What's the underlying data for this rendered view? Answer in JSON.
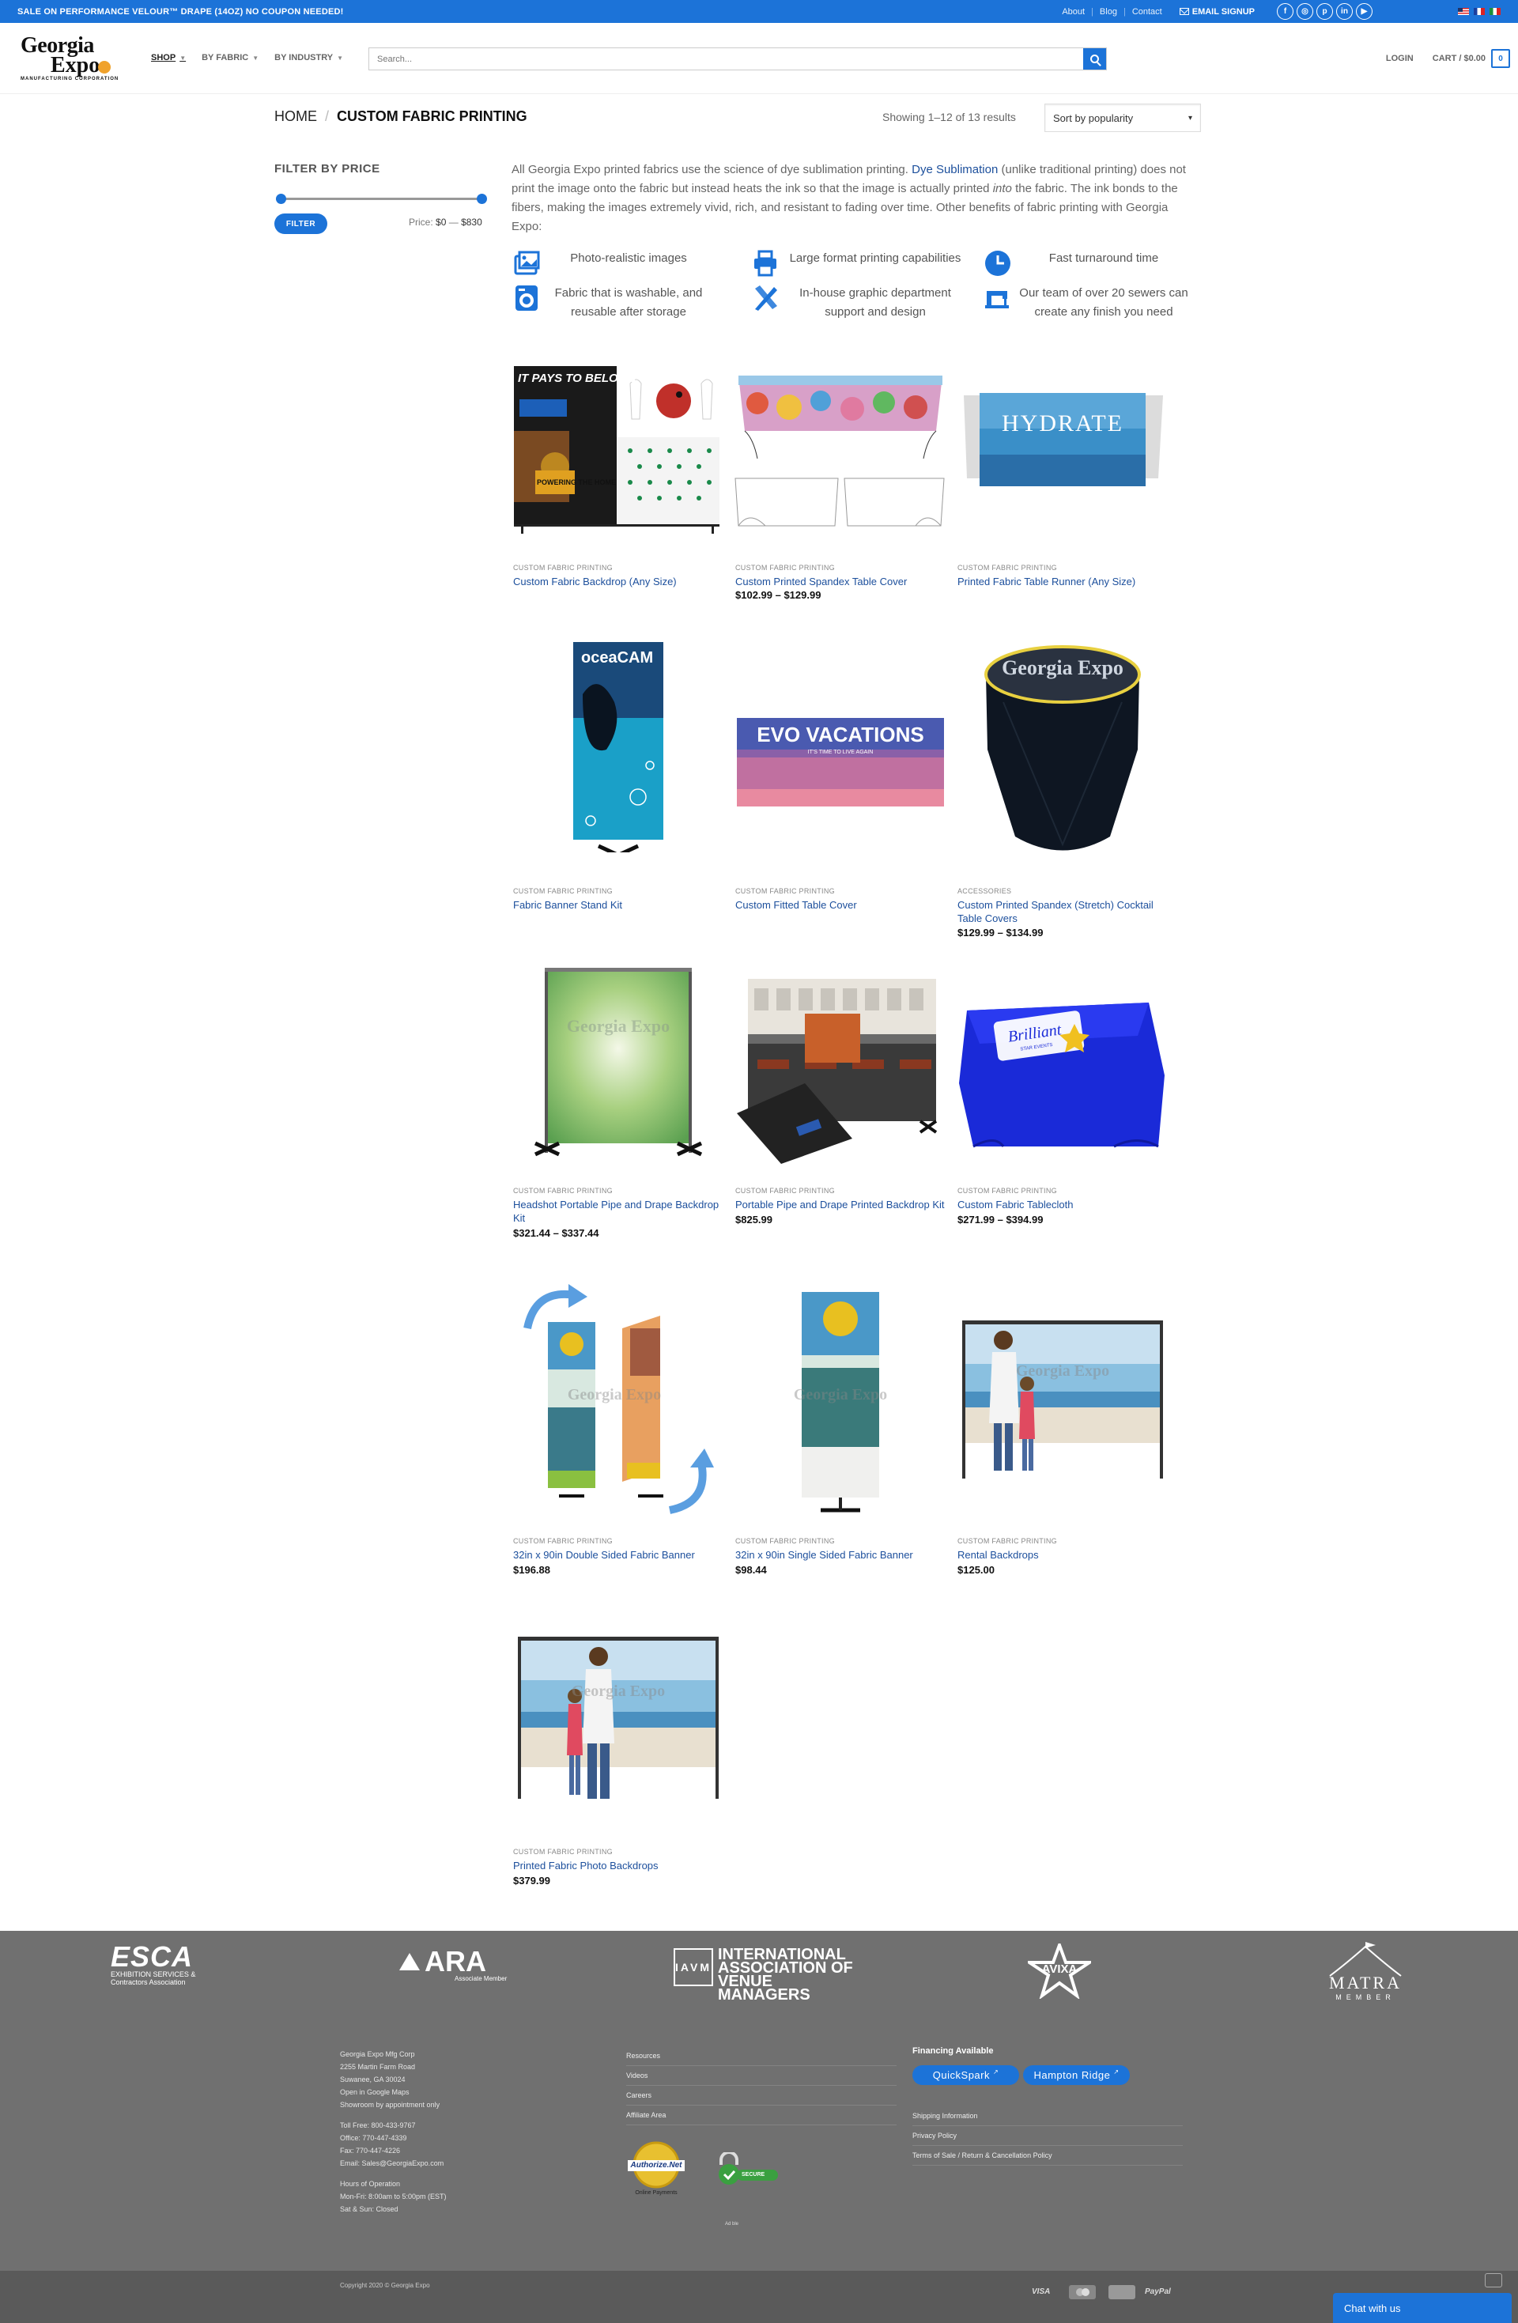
{
  "topbar": {
    "promo": "SALE ON PERFORMANCE VELOUR™ DRAPE (14OZ) NO COUPON NEEDED!",
    "links": [
      "About",
      "Blog",
      "Contact"
    ],
    "signup": "EMAIL SIGNUP"
  },
  "header": {
    "logo_line1": "Georgia",
    "logo_line2": "Expo",
    "logo_tagline": "MANUFACTURING CORPORATION",
    "nav": [
      "SHOP",
      "BY FABRIC",
      "BY INDUSTRY"
    ],
    "search_placeholder": "Search...",
    "login": "LOGIN",
    "cart": "CART / $0.00",
    "cart_count": "0"
  },
  "breadcrumb": {
    "home": "HOME",
    "sep": "/",
    "current": "CUSTOM FABRIC PRINTING"
  },
  "results": "Showing 1–12 of 13 results",
  "sort": "Sort by popularity",
  "sidebar": {
    "title": "FILTER BY PRICE",
    "button": "FILTER",
    "price_label": "Price:",
    "price_min": "$0",
    "price_dash": "—",
    "price_max": "$830"
  },
  "intro": {
    "p1": "All Georgia Expo printed fabrics use the science of dye sublimation printing.",
    "link": "Dye Sublimation",
    "p2": "(unlike traditional printing) does not print the image onto the fabric but instead heats the ink so that the image is actually printed",
    "em": "into",
    "p3": "the fabric. The ink bonds to the fibers, making the images extremely vivid, rich, and resistant to fading over time. Other benefits of fabric printing with Georgia Expo:"
  },
  "features": [
    {
      "icon": "photo-icon",
      "text": "Photo-realistic images"
    },
    {
      "icon": "printer-icon",
      "text": "Large format printing capabilities"
    },
    {
      "icon": "clock-icon",
      "text": "Fast turnaround time"
    },
    {
      "icon": "washer-icon",
      "text": "Fabric that is washable, and reusable after storage"
    },
    {
      "icon": "design-tools-icon",
      "text": "In-house graphic department support and design"
    },
    {
      "icon": "sewing-machine-icon",
      "text": "Our team of over 20 sewers can create any finish you need"
    }
  ],
  "products": [
    {
      "category": "CUSTOM FABRIC PRINTING",
      "name": "Custom Fabric Backdrop (Any Size)",
      "price": ""
    },
    {
      "category": "CUSTOM FABRIC PRINTING",
      "name": "Custom Printed Spandex Table Cover",
      "price": "$102.99 – $129.99"
    },
    {
      "category": "CUSTOM FABRIC PRINTING",
      "name": "Printed Fabric Table Runner (Any Size)",
      "price": ""
    },
    {
      "category": "CUSTOM FABRIC PRINTING",
      "name": "Fabric Banner Stand Kit",
      "price": ""
    },
    {
      "category": "CUSTOM FABRIC PRINTING",
      "name": "Custom Fitted Table Cover",
      "price": ""
    },
    {
      "category": "ACCESSORIES",
      "name": "Custom Printed Spandex (Stretch) Cocktail Table Covers",
      "price": "$129.99 – $134.99"
    },
    {
      "category": "CUSTOM FABRIC PRINTING",
      "name": "Headshot Portable Pipe and Drape Backdrop Kit",
      "price": "$321.44 – $337.44"
    },
    {
      "category": "CUSTOM FABRIC PRINTING",
      "name": "Portable Pipe and Drape Printed Backdrop Kit",
      "price": "$825.99"
    },
    {
      "category": "CUSTOM FABRIC PRINTING",
      "name": "Custom Fabric Tablecloth",
      "price": "$271.99 – $394.99"
    },
    {
      "category": "CUSTOM FABRIC PRINTING",
      "name": "32in x 90in Double Sided Fabric Banner",
      "price": "$196.88"
    },
    {
      "category": "CUSTOM FABRIC PRINTING",
      "name": "32in x 90in Single Sided Fabric Banner",
      "price": "$98.44"
    },
    {
      "category": "CUSTOM FABRIC PRINTING",
      "name": "Rental Backdrops",
      "price": "$125.00"
    },
    {
      "category": "CUSTOM FABRIC PRINTING",
      "name": "Printed Fabric Photo Backdrops",
      "price": "$379.99"
    }
  ],
  "product_art": {
    "backdrop_title": "IT PAYS TO BELONG",
    "backdrop_sub": "POWERING THE HOME",
    "runner_text": "HYDRATE",
    "banner_text": "oceaCAM",
    "fitted_text": "EVO VACATIONS",
    "fitted_sub": "IT'S TIME TO LIVE AGAIN",
    "cocktail_text": "Georgia Expo",
    "tablecloth_text": "Brilliant",
    "tablecloth_sub": "STAR EVENTS",
    "watermark": "Georgia Expo"
  },
  "footer": {
    "members": [
      {
        "name": "ESCA",
        "sub": "EXHIBITION SERVICES & Contractors Association"
      },
      {
        "name": "ARA",
        "sub": "Associate Member"
      },
      {
        "name": "IAVM",
        "sub": "INTERNATIONAL ASSOCIATION OF VENUE MANAGERS"
      },
      {
        "name": "AVIXA",
        "sub": ""
      },
      {
        "name": "MATRA",
        "sub": "MEMBER"
      }
    ],
    "address": [
      "Georgia Expo Mfg Corp",
      "2255 Martin Farm Road",
      "Suwanee, GA 30024",
      "Open in Google Maps",
      "Showroom by appointment only"
    ],
    "phones": [
      "Toll Free: 800-433-9767",
      "Office: 770-447-4339",
      "Fax: 770-447-4226",
      "Email: Sales@GeorgiaExpo.com"
    ],
    "hours": [
      "Hours of Operation",
      "Mon-Fri: 8:00am to 5:00pm (EST)",
      "Sat & Sun: Closed"
    ],
    "links_mid": [
      "Resources",
      "Videos",
      "Careers",
      "Affiliate Area"
    ],
    "financing": "Financing Available",
    "fin_buttons": [
      "QuickSpark",
      "Hampton Ridge"
    ],
    "links_right": [
      "Shipping Information",
      "Privacy Policy",
      "Terms of Sale / Return & Cancellation Policy"
    ],
    "badge1": "Authorize.Net",
    "badge1_sub": "Online Payments",
    "badge2": "SECURE",
    "tiny": "Ad ble",
    "copyright": "Copyright 2020 © Georgia Expo",
    "payments": [
      "VISA",
      "Mastercard",
      "AMEX",
      "PayPal"
    ],
    "chat": "Chat with us"
  },
  "colors": {
    "accent": "#1c73d8",
    "link": "#1c4f9c",
    "footer": "#707070",
    "footer_bottom": "#5a5a5a"
  }
}
